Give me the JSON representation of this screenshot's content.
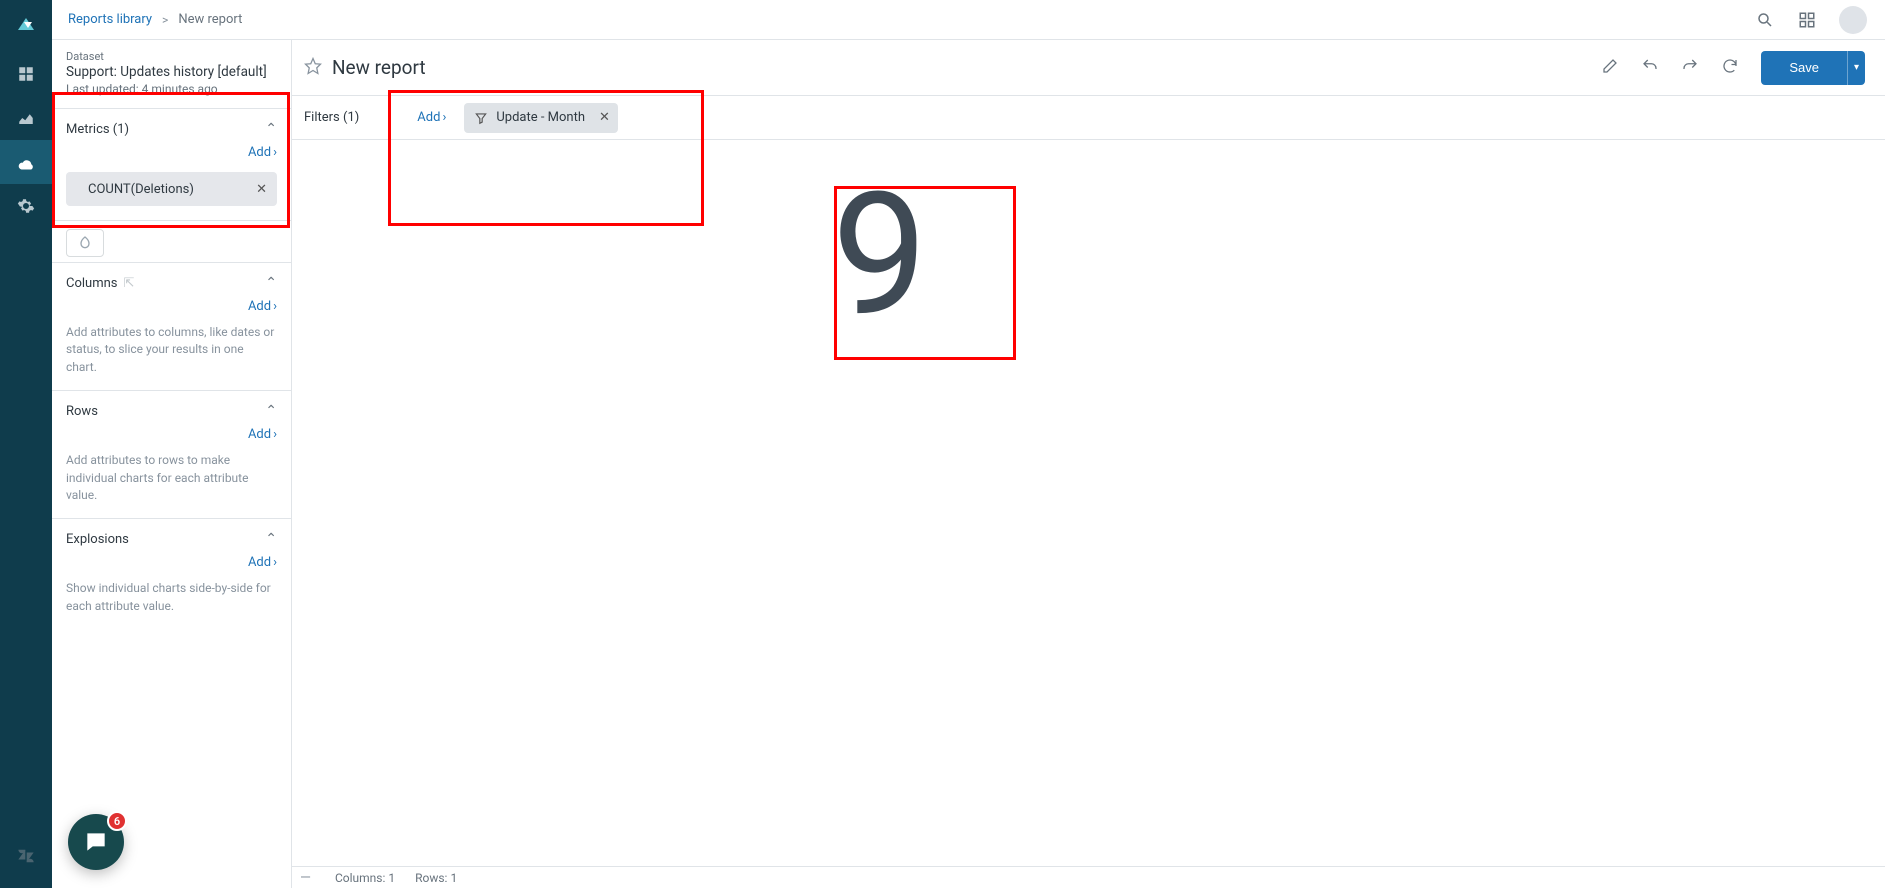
{
  "breadcrumb": {
    "root": "Reports library",
    "current": "New report"
  },
  "dataset": {
    "label": "Dataset",
    "name": "Support: Updates history [default]",
    "updated": "Last updated: 4 minutes ago"
  },
  "sections": {
    "metrics": {
      "title": "Metrics (1)",
      "add": "Add",
      "chip": "COUNT(Deletions)"
    },
    "columns": {
      "title": "Columns",
      "add": "Add",
      "hint": "Add attributes to columns, like dates or status, to slice your results in one chart."
    },
    "rows": {
      "title": "Rows",
      "add": "Add",
      "hint": "Add attributes to rows to make individual charts for each attribute value."
    },
    "explosions": {
      "title": "Explosions",
      "add": "Add",
      "hint": "Show individual charts side-by-side for each attribute value."
    }
  },
  "header": {
    "title": "New report",
    "save": "Save"
  },
  "filters": {
    "label": "Filters (1)",
    "add": "Add",
    "chip": "Update - Month"
  },
  "result_value": "9",
  "status": {
    "columns": "Columns: 1",
    "rows": "Rows: 1"
  },
  "chat_badge": "6"
}
